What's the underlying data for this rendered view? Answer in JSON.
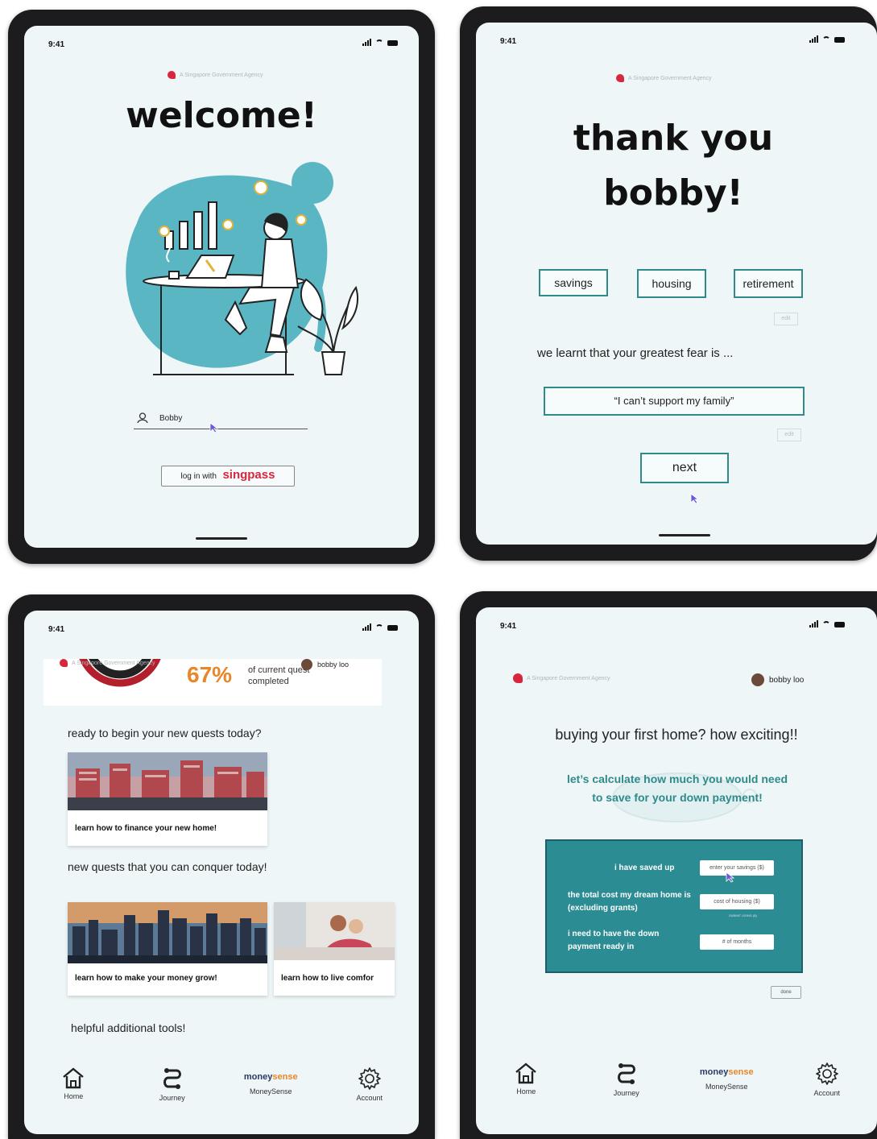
{
  "status": {
    "time": "9:41"
  },
  "agency": "A Singapore Government Agency",
  "screen1": {
    "title": "welcome!",
    "username": "Bobby",
    "login_prefix": "log in with",
    "login_brand": "singpass"
  },
  "screen2": {
    "title_line1": "thank you",
    "title_line2": "bobby!",
    "goals": [
      "savings",
      "housing",
      "retirement"
    ],
    "edit_label": "edit",
    "fear_prompt": "we learnt that your greatest fear is ...",
    "fear_value": "“I can’t support my family”",
    "next_label": "next"
  },
  "screen3": {
    "user_name": "bobby loo",
    "progress": "67%",
    "progress_value": 0.67,
    "progress_caption_1": "of current quest",
    "progress_caption_2": "completed",
    "section1": "ready to begin your new quests today?",
    "card1": "learn how to finance your new home!",
    "section2": "new quests that you can conquer today!",
    "card2": "learn how to make your money grow!",
    "card3": "learn how to live comfor",
    "section3": "helpful additional tools!"
  },
  "screen4": {
    "user_name": "bobby loo",
    "heading": "buying your first home? how exciting!!",
    "subheading": "let’s calculate how much you would need to save for your down payment!",
    "row1_label": "i have saved up",
    "row1_placeholder": "enter your savings ($)",
    "row2_label": "the total cost my dream home is (excluding grants)",
    "row2_placeholder": "cost of housing ($)",
    "row2_hint": "SUBMIT USING ($)",
    "row3_label": "i need to have the down payment ready in",
    "row3_placeholder": "# of months",
    "done_label": "done"
  },
  "nav": [
    {
      "label": "Home",
      "icon": "home-icon"
    },
    {
      "label": "Journey",
      "icon": "journey-icon"
    },
    {
      "label": "MoneySense",
      "icon": "moneysense-logo",
      "logo_a": "money",
      "logo_b": "sense"
    },
    {
      "label": "Account",
      "icon": "gear-icon"
    }
  ],
  "colors": {
    "teal": "#2e8b89",
    "panel": "#2c8c94",
    "orange": "#e8872a",
    "singpass_red": "#d7263d",
    "screen_bg": "#eef6f8"
  }
}
